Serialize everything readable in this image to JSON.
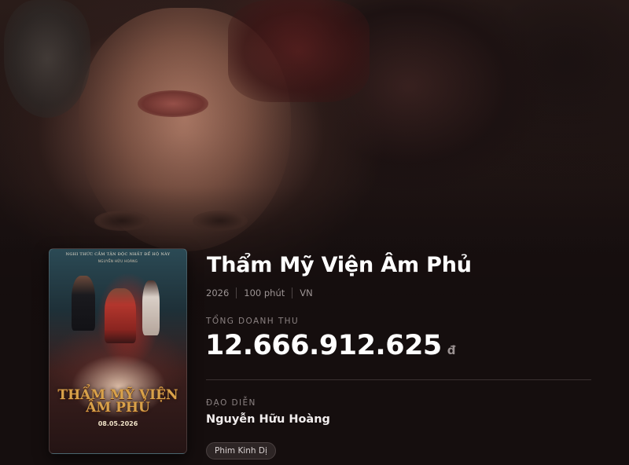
{
  "movie": {
    "title": "Thẩm Mỹ Viện Âm Phủ",
    "year": "2026",
    "duration": "100 phút",
    "country": "VN",
    "revenue_label": "TỔNG DOANH THU",
    "revenue_value": "12.666.912.625",
    "revenue_currency": "đ",
    "director_label": "ĐẠO DIỄN",
    "director_name": "Nguyễn Hữu Hoàng",
    "genres": [
      "Phim Kinh Dị"
    ]
  },
  "poster": {
    "tagline": "NGHI THỨC CẮM TẬN ĐỘC NHẤT ĐỂ HỘ NÀY",
    "director_credit": "NGUYỄN HỮU HOÀNG",
    "title_line1": "THẨM MỸ VIỆN",
    "title_line2": "ÂM PHỦ",
    "release_date": "08.05.2026"
  },
  "colors": {
    "background": "#140d0d",
    "title": "#ffffff",
    "muted_text": "#9c9494",
    "poster_title": "#d9a24a"
  }
}
